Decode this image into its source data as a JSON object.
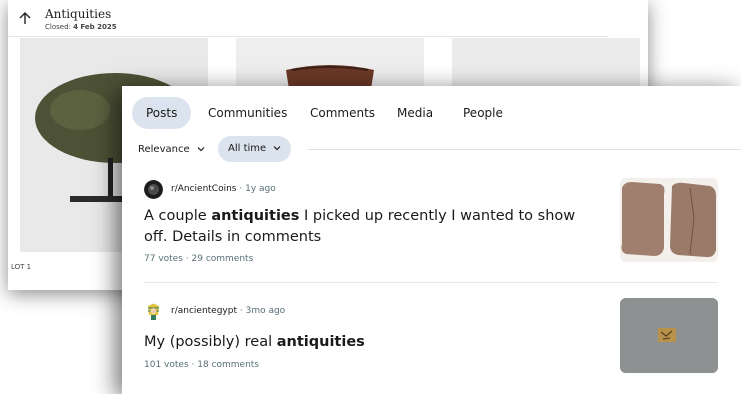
{
  "auction": {
    "title": "Antiquities",
    "closed_label": "Closed:",
    "closed_date": "4 Feb 2025",
    "lot_label": "LOT 1"
  },
  "search": {
    "tabs": [
      {
        "label": "Posts",
        "active": true
      },
      {
        "label": "Communities",
        "active": false
      },
      {
        "label": "Comments",
        "active": false
      },
      {
        "label": "Media",
        "active": false
      },
      {
        "label": "People",
        "active": false
      }
    ],
    "sort_label": "Relevance",
    "time_label": "All time"
  },
  "posts": [
    {
      "subreddit": "r/AncientCoins",
      "age": "1y ago",
      "title_pre": "A couple ",
      "title_bold": "antiquities",
      "title_post": " I picked up recently I wanted to show off. Details in comments",
      "votes": "77 votes",
      "comments": "29 comments"
    },
    {
      "subreddit": "r/ancientegypt",
      "age": "3mo ago",
      "title_pre": "My (possibly) real ",
      "title_bold": "antiquities",
      "title_post": "",
      "votes": "101 votes",
      "comments": "18 comments"
    }
  ],
  "colors": {
    "active_tab_bg": "#dbe4ee",
    "meta_text": "#576f76"
  }
}
